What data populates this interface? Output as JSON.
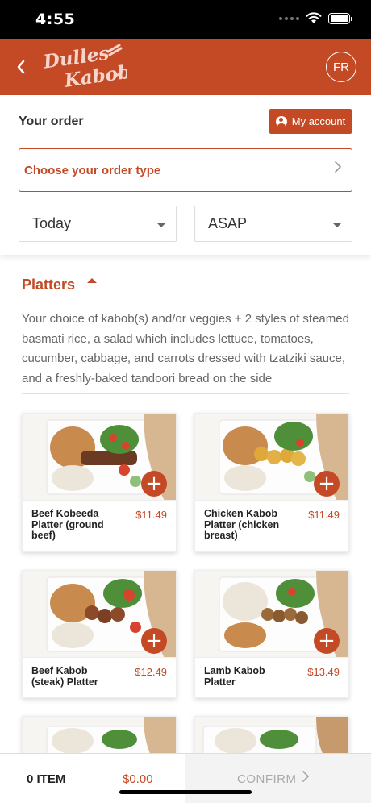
{
  "status": {
    "time": "4:55"
  },
  "header": {
    "logo_line1": "Dulles",
    "logo_line2": "Kabob",
    "lang": "FR"
  },
  "order": {
    "title": "Your order",
    "account_label": "My account",
    "order_type_label": "Choose your order type",
    "day_value": "Today",
    "time_value": "ASAP"
  },
  "category": {
    "title": "Platters",
    "description": "Your choice of kabob(s) and/or veggies + 2 styles of steamed basmati rice, a salad which includes lettuce, tomatoes, cucumber, cabbage, and carrots dressed with tzatziki sauce, and a freshly-baked tandoori bread on the side"
  },
  "products": [
    {
      "name": "Beef Kobeeda Platter (ground beef)",
      "price": "$11.49"
    },
    {
      "name": "Chicken Kabob Platter (chicken breast)",
      "price": "$11.49"
    },
    {
      "name": "Beef Kabob (steak) Platter",
      "price": "$12.49"
    },
    {
      "name": "Lamb Kabob Platter",
      "price": "$13.49"
    }
  ],
  "cart": {
    "count_label": "0 ITEM",
    "total": "$0.00",
    "confirm_label": "CONFIRM"
  },
  "colors": {
    "brand": "#c44a25",
    "status_bar": "#000000"
  }
}
